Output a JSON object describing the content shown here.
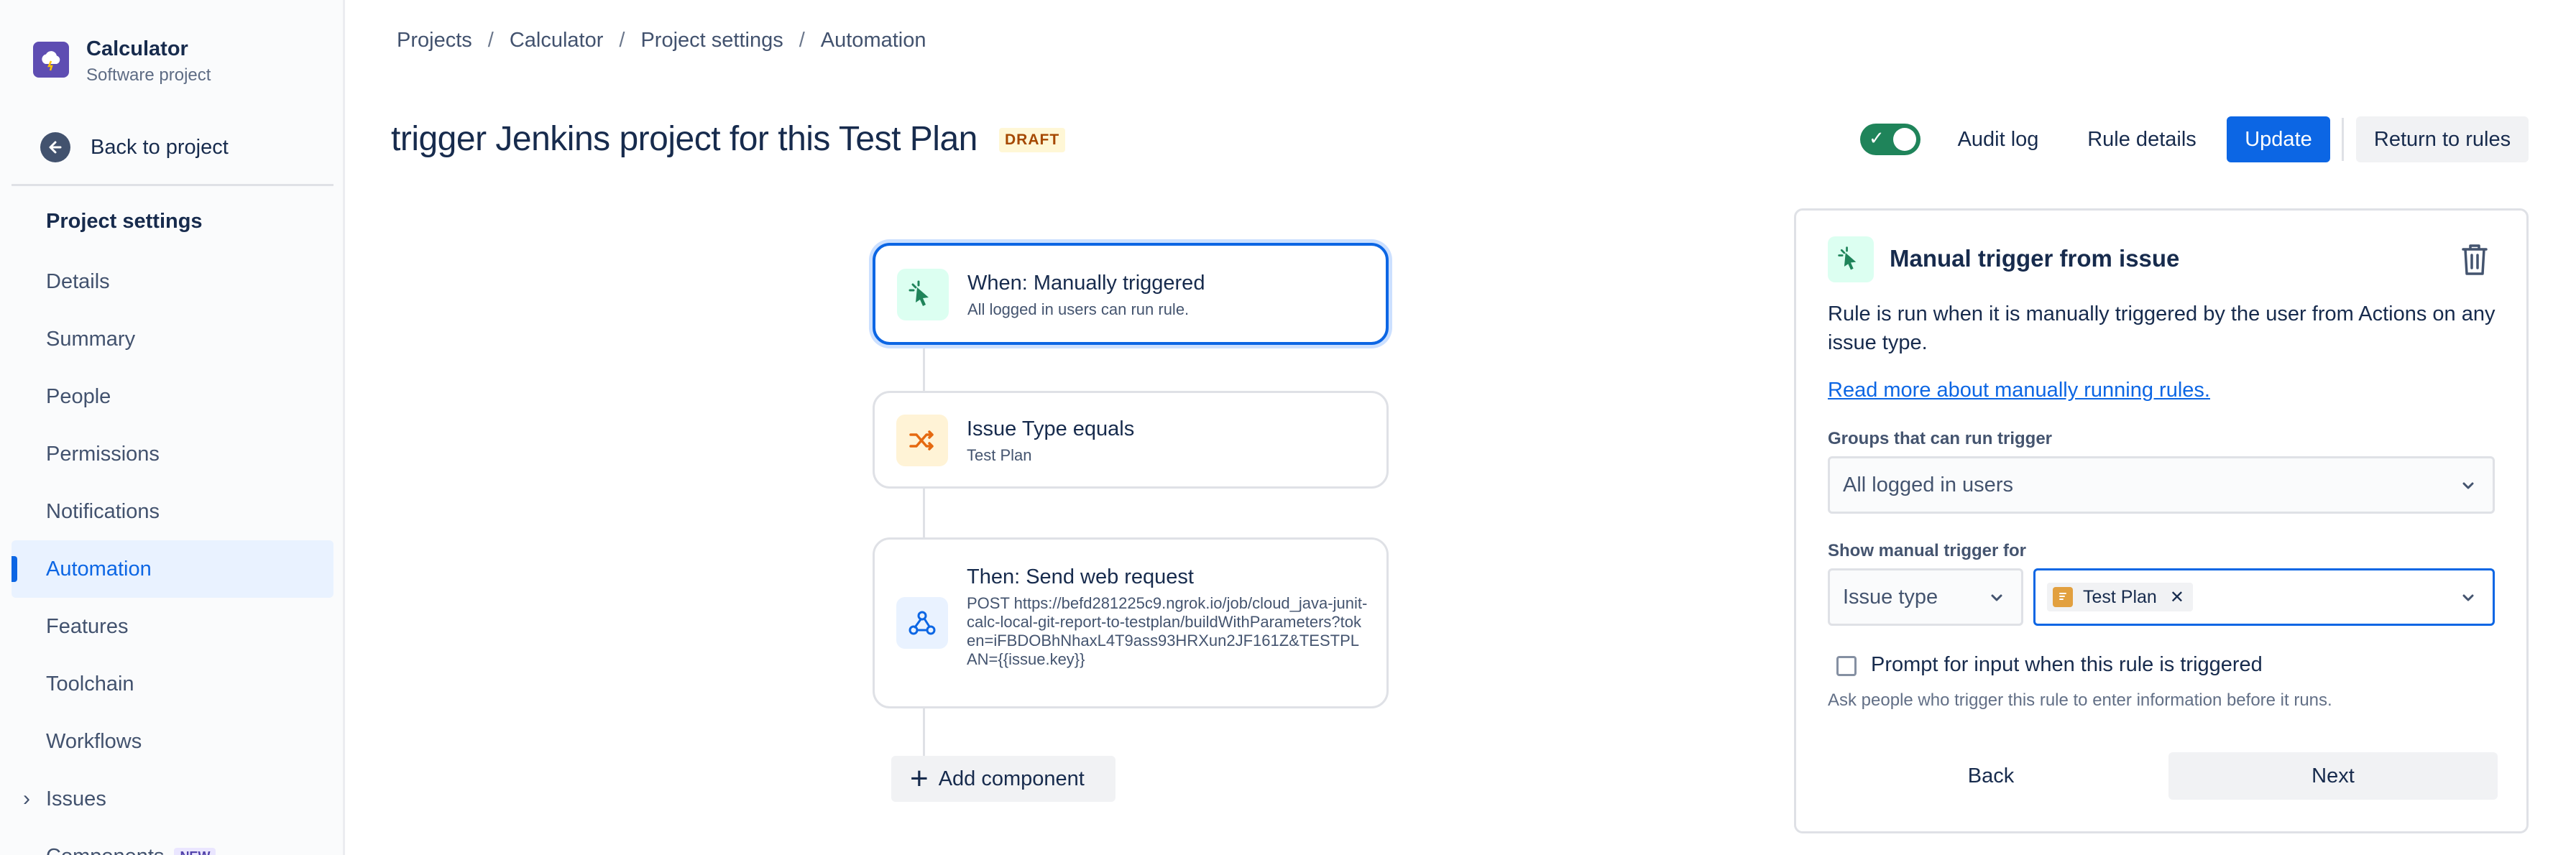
{
  "sidebar": {
    "project_name": "Calculator",
    "project_type": "Software project",
    "back_label": "Back to project",
    "section_title": "Project settings",
    "items": [
      {
        "label": "Details"
      },
      {
        "label": "Summary"
      },
      {
        "label": "People"
      },
      {
        "label": "Permissions"
      },
      {
        "label": "Notifications"
      },
      {
        "label": "Automation"
      },
      {
        "label": "Features"
      },
      {
        "label": "Toolchain"
      },
      {
        "label": "Workflows"
      },
      {
        "label": "Issues"
      },
      {
        "label": "Components",
        "badge": "NEW"
      }
    ]
  },
  "breadcrumb": [
    "Projects",
    "Calculator",
    "Project settings",
    "Automation"
  ],
  "breadcrumb_sep": "/",
  "header": {
    "title": "trigger Jenkins project for this Test Plan",
    "status": "DRAFT",
    "toggle_on": true,
    "audit_log": "Audit log",
    "rule_details": "Rule details",
    "update": "Update",
    "return_to_rules": "Return to rules"
  },
  "flow": {
    "trigger": {
      "title": "When: Manually triggered",
      "subtitle": "All logged in users can run rule.",
      "icon": "cursor-click-icon"
    },
    "condition": {
      "title": "Issue Type equals",
      "subtitle": "Test Plan",
      "icon": "shuffle-icon"
    },
    "action": {
      "title": "Then: Send web request",
      "subtitle": "POST https://befd281225c9.ngrok.io/job/cloud_java-junit-calc-local-git-report-to-testplan/buildWithParameters?token=iFBDOBhNhaxL4T9ass93HRXun2JF161Z&TESTPLAN={{issue.key}}",
      "icon": "webhook-icon"
    },
    "add_component": "Add component"
  },
  "panel": {
    "title": "Manual trigger from issue",
    "description": "Rule is run when it is manually triggered by the user from Actions on any issue type.",
    "link": "Read more about manually running rules.",
    "groups_label": "Groups that can run trigger",
    "groups_value": "All logged in users",
    "show_label": "Show manual trigger for",
    "show_type_value": "Issue type",
    "show_tag": "Test Plan",
    "checkbox_label": "Prompt for input when this rule is triggered",
    "checkbox_help": "Ask people who trigger this rule to enter information before it runs.",
    "back": "Back",
    "next": "Next"
  },
  "colors": {
    "primary": "#0c66e4",
    "toggle_on": "#1f845a",
    "draft_bg": "#fff7d6",
    "draft_text": "#a54800"
  }
}
